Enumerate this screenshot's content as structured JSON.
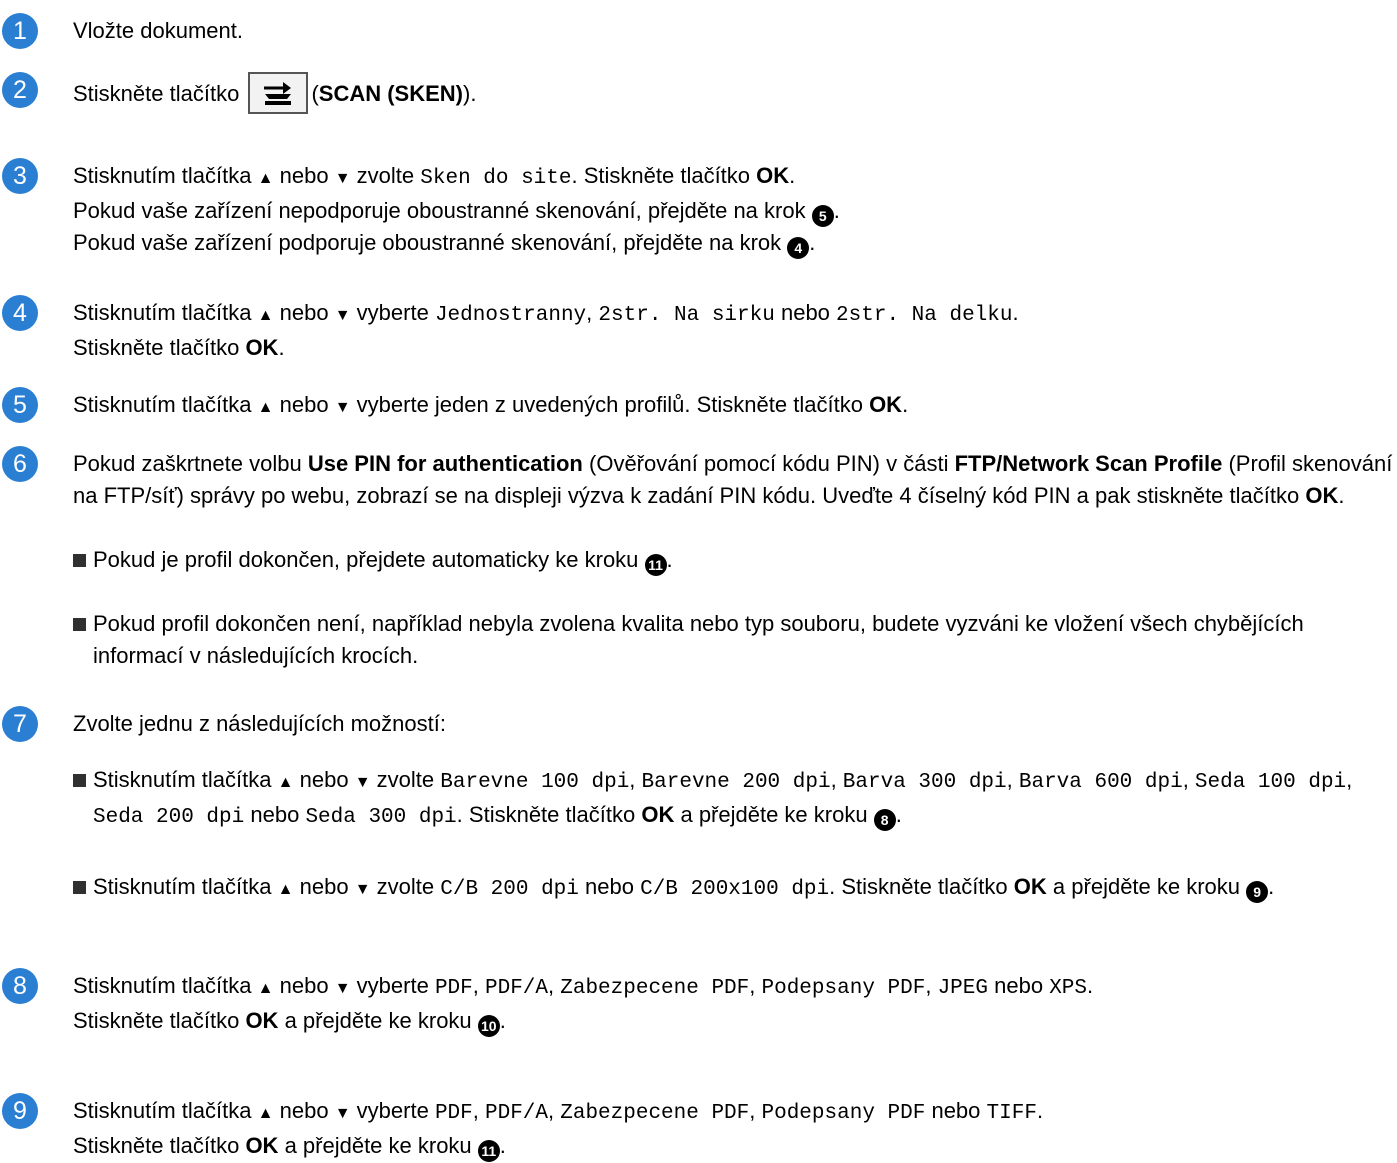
{
  "steps": {
    "s1": {
      "num": "1",
      "text": "Vložte dokument."
    },
    "s2": {
      "num": "2",
      "pre": "Stiskněte tlačítko",
      "open": "(",
      "bold": "SCAN (SKEN)",
      "close": ")."
    },
    "s3": {
      "num": "3",
      "pre": "Stisknutím tlačítka",
      "up": "▲",
      "or": "nebo",
      "down": "▼",
      "choose": "zvolte",
      "mono": "Sken do site",
      "post": ". Stiskněte tlačítko",
      "ok": "OK",
      "end": ".",
      "line2": "Pokud vaše zařízení nepodporuje oboustranné skenování, přejděte na krok",
      "line2_ref": "5",
      "line3": "Pokud vaše zařízení podporuje oboustranné skenování, přejděte na krok",
      "line3_ref": "4"
    },
    "s4": {
      "num": "4",
      "pre": "Stisknutím tlačítka",
      "up": "▲",
      "or": "nebo",
      "down": "▼",
      "choose": "vyberte",
      "m1": "Jednostranny",
      "m2": "2str. Na sirku",
      "or2": "nebo",
      "m3": "2str. Na delku",
      "line2": "Stiskněte tlačítko",
      "ok": "OK"
    },
    "s5": {
      "num": "5",
      "pre": "Stisknutím tlačítka",
      "up": "▲",
      "or": "nebo",
      "down": "▼",
      "post": "vyberte jeden z uvedených profilů. Stiskněte tlačítko",
      "ok": "OK"
    },
    "s6": {
      "num": "6",
      "t1": "Pokud zaškrtnete volbu",
      "b1": "Use PIN for authentication",
      "t2": "(Ověřování pomocí kódu PIN) v části",
      "b2": "FTP/Network Scan Profile",
      "t3": "(Profil skenování na FTP/síť) správy po webu, zobrazí se na displeji výzva k zadání PIN kódu. Uveďte 4 číselný kód PIN a pak stiskněte tlačítko",
      "ok": "OK",
      "bullet1": "Pokud je profil dokončen, přejdete automaticky ke kroku",
      "bullet1_ref": "11",
      "bullet2": "Pokud profil dokončen není, například nebyla zvolena kvalita nebo typ souboru, budete vyzváni ke vložení všech chybějících informací v následujících krocích."
    },
    "s7": {
      "num": "7",
      "text": "Zvolte jednu z následujících možností:",
      "b1_pre": "Stisknutím tlačítka",
      "up": "▲",
      "or": "nebo",
      "down": "▼",
      "choose": "zvolte",
      "b1_m1": "Barevne 100 dpi",
      "b1_m2": "Barevne 200 dpi",
      "b1_m3": "Barva 300 dpi",
      "b1_m4": "Barva 600 dpi",
      "b1_m5": "Seda 100 dpi",
      "b1_m6": "Seda 200 dpi",
      "b1_m7": "Seda 300 dpi",
      "b1_post": "Stiskněte tlačítko",
      "ok": "OK",
      "b1_tail": "a přejděte ke kroku",
      "b1_ref": "8",
      "b2_m1": "C/B 200 dpi",
      "b2_m2": "C/B 200x100 dpi",
      "b2_post": "Stiskněte tlačítko",
      "b2_tail": "a přejděte ke kroku",
      "b2_ref": "9"
    },
    "s8": {
      "num": "8",
      "pre": "Stisknutím tlačítka",
      "up": "▲",
      "or": "nebo",
      "down": "▼",
      "choose": "vyberte",
      "m1": "PDF",
      "m2": "PDF/A",
      "m3": "Zabezpecene PDF",
      "m4": "Podepsany PDF",
      "m5": "JPEG",
      "or2": "nebo",
      "m6": "XPS",
      "line2": "Stiskněte tlačítko",
      "ok": "OK",
      "tail": "a přejděte ke kroku",
      "ref": "10"
    },
    "s9": {
      "num": "9",
      "pre": "Stisknutím tlačítka",
      "up": "▲",
      "or": "nebo",
      "down": "▼",
      "choose": "vyberte",
      "m1": "PDF",
      "m2": "PDF/A",
      "m3": "Zabezpecene PDF",
      "m4": "Podepsany PDF",
      "or2": "nebo",
      "m5": "TIFF",
      "line2": "Stiskněte tlačítko",
      "ok": "OK",
      "tail": "a přejděte ke kroku",
      "ref": "11"
    }
  },
  "colors": {
    "step_badge": "#2a7fd3",
    "text": "#000000"
  },
  "icons": {
    "scan_button": "scan-icon"
  }
}
